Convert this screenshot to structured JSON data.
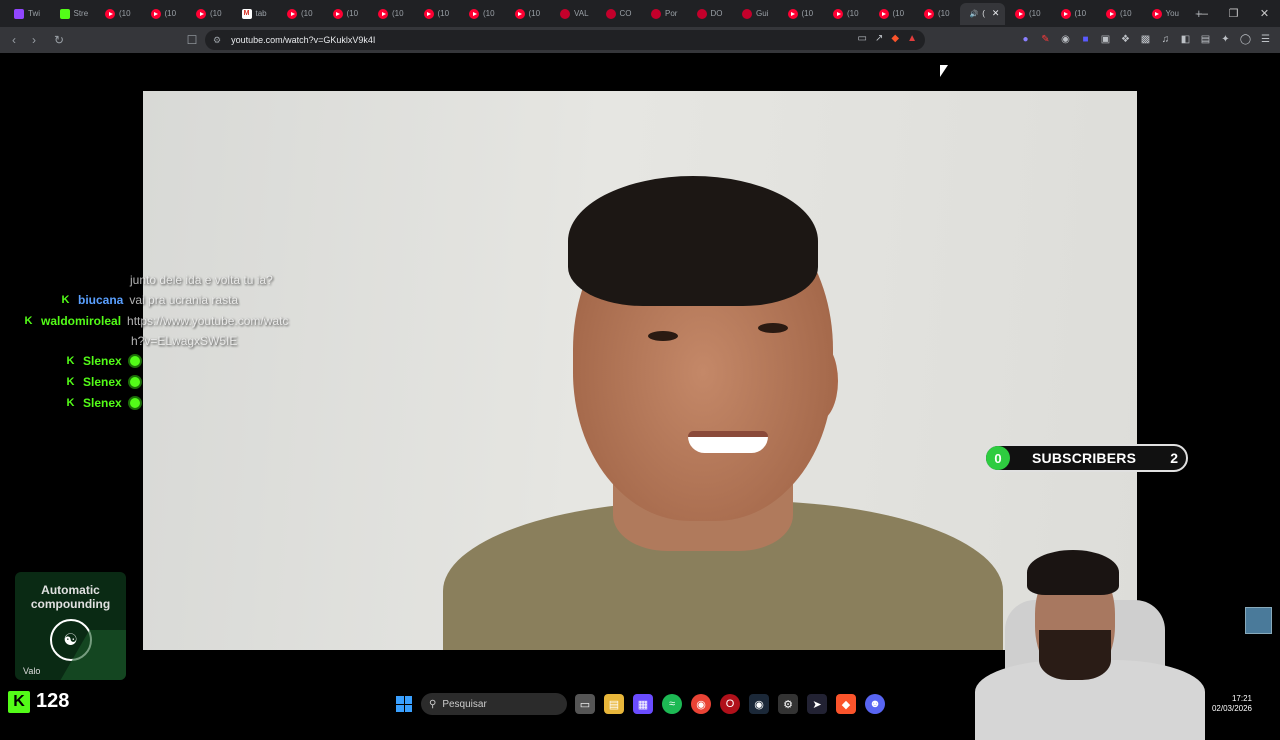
{
  "browser": {
    "tabs": [
      {
        "label": "Twi",
        "icon": "twitch-icon"
      },
      {
        "label": "Stre",
        "icon": "kick-icon"
      },
      {
        "label": "(10",
        "icon": "youtube-icon"
      },
      {
        "label": "(10",
        "icon": "youtube-icon"
      },
      {
        "label": "(10",
        "icon": "youtube-icon"
      },
      {
        "label": "tab",
        "icon": "gmail-icon"
      },
      {
        "label": "(10",
        "icon": "youtube-icon"
      },
      {
        "label": "(10",
        "icon": "youtube-icon"
      },
      {
        "label": "(10",
        "icon": "youtube-icon"
      },
      {
        "label": "(10",
        "icon": "youtube-icon"
      },
      {
        "label": "(10",
        "icon": "youtube-icon"
      },
      {
        "label": "(10",
        "icon": "youtube-icon"
      },
      {
        "label": "VAL",
        "icon": "circle-icon"
      },
      {
        "label": "CO",
        "icon": "circle-icon"
      },
      {
        "label": "Por",
        "icon": "circle-icon"
      },
      {
        "label": "DO",
        "icon": "circle-icon"
      },
      {
        "label": "Gui",
        "icon": "circle-icon"
      },
      {
        "label": "(10",
        "icon": "youtube-icon"
      },
      {
        "label": "(10",
        "icon": "youtube-icon"
      },
      {
        "label": "(10",
        "icon": "youtube-icon"
      },
      {
        "label": "(10",
        "icon": "youtube-icon"
      },
      {
        "label": "(",
        "icon": "speaker-icon",
        "active": true
      },
      {
        "label": "(10",
        "icon": "youtube-icon"
      },
      {
        "label": "(10",
        "icon": "youtube-icon"
      },
      {
        "label": "(10",
        "icon": "youtube-icon"
      },
      {
        "label": "You",
        "icon": "youtube-icon"
      }
    ],
    "url": "youtube.com/watch?v=GKuklxV9k4I"
  },
  "chat": [
    {
      "user": "",
      "message": "junto dele ida e volta tu ia?",
      "badge": false,
      "color": "green"
    },
    {
      "user": "biucana",
      "message": "vai pra ucrania rasta",
      "badge": true,
      "color": "blue"
    },
    {
      "user": "waldomiroleal",
      "message": "https://www.youtube.com/watc",
      "badge": true,
      "color": "green"
    },
    {
      "user": "",
      "message": "h?v=ELwagxSW5IE",
      "badge": false,
      "color": "green"
    },
    {
      "user": "Slenex",
      "message": "",
      "badge": true,
      "color": "green",
      "emote": true
    },
    {
      "user": "Slenex",
      "message": "",
      "badge": true,
      "color": "green",
      "emote": true
    },
    {
      "user": "Slenex",
      "message": "",
      "badge": true,
      "color": "green",
      "emote": true
    }
  ],
  "subscribers": {
    "left_count": "0",
    "label": "SUBSCRIBERS",
    "right_count": "2"
  },
  "ad": {
    "title_line1": "Automatic",
    "title_line2": "compounding",
    "footer": "Valo"
  },
  "viewer_count": "128",
  "taskbar": {
    "search_placeholder": "Pesquisar",
    "time": "17:21",
    "date": "02/03/2026"
  },
  "colors": {
    "kick_green": "#53fc18",
    "youtube_red": "#ff0033",
    "sub_green": "#2ecc40"
  }
}
